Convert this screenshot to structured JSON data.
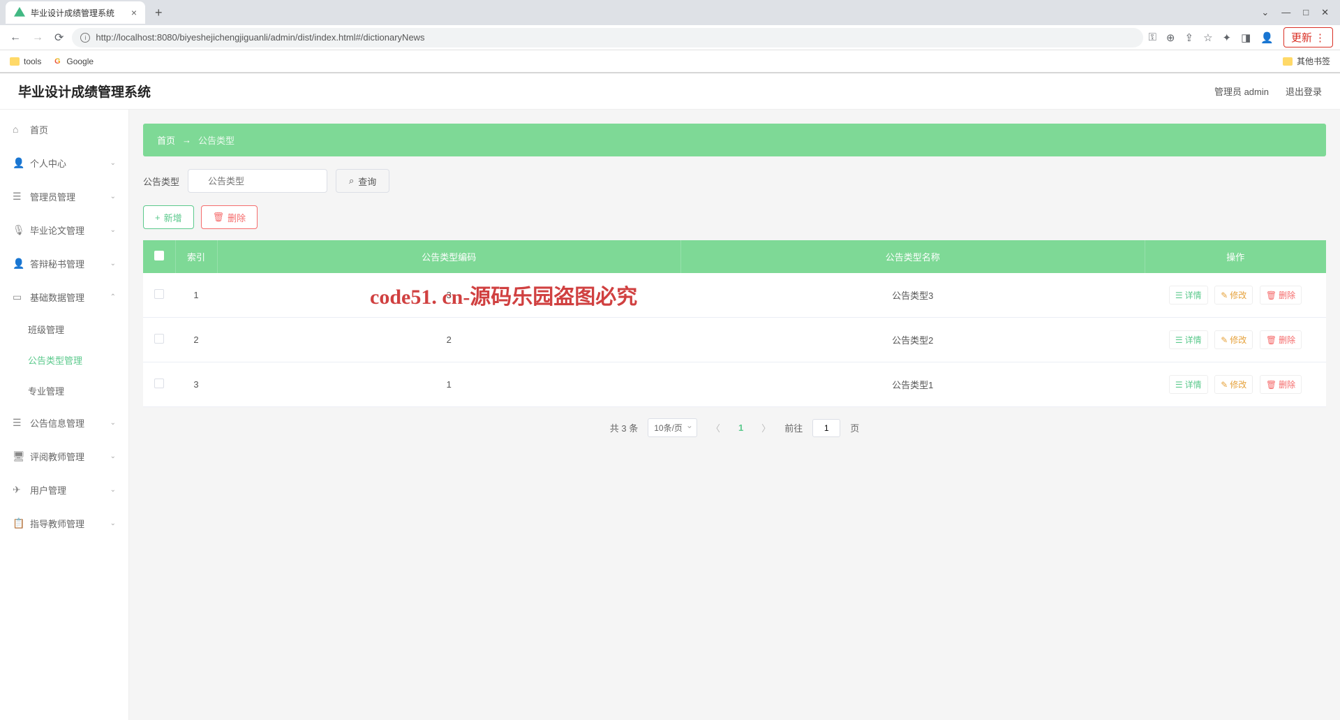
{
  "browser": {
    "tab_title": "毕业设计成绩管理系统",
    "url": "http://localhost:8080/biyeshejichengjiguanli/admin/dist/index.html#/dictionaryNews",
    "update_label": "更新",
    "bookmarks": {
      "tools": "tools",
      "google": "Google",
      "other": "其他书签"
    }
  },
  "header": {
    "title": "毕业设计成绩管理系统",
    "user": "管理员 admin",
    "logout": "退出登录"
  },
  "sidebar": {
    "items": [
      {
        "icon": "⌂",
        "label": "首页",
        "expandable": false
      },
      {
        "icon": "👤",
        "label": "个人中心",
        "expandable": true
      },
      {
        "icon": "☰",
        "label": "管理员管理",
        "expandable": true
      },
      {
        "icon": "🎙",
        "label": "毕业论文管理",
        "expandable": true
      },
      {
        "icon": "👤",
        "label": "答辩秘书管理",
        "expandable": true
      },
      {
        "icon": "▭",
        "label": "基础数据管理",
        "expandable": true,
        "expanded": true
      },
      {
        "icon": "☰",
        "label": "公告信息管理",
        "expandable": true
      },
      {
        "icon": "🖥",
        "label": "评阅教师管理",
        "expandable": true
      },
      {
        "icon": "✈",
        "label": "用户管理",
        "expandable": true
      },
      {
        "icon": "📋",
        "label": "指导教师管理",
        "expandable": true
      }
    ],
    "submenu": [
      {
        "label": "班级管理",
        "active": false
      },
      {
        "label": "公告类型管理",
        "active": true
      },
      {
        "label": "专业管理",
        "active": false
      }
    ]
  },
  "breadcrumb": {
    "home": "首页",
    "sep": "→",
    "current": "公告类型"
  },
  "search": {
    "label": "公告类型",
    "placeholder": "公告类型",
    "button": "查询"
  },
  "actions": {
    "add": "新增",
    "delete": "删除"
  },
  "table": {
    "headers": [
      "",
      "索引",
      "公告类型编码",
      "公告类型名称",
      "操作"
    ],
    "ops": {
      "view": "详情",
      "edit": "修改",
      "del": "删除"
    },
    "rows": [
      {
        "index": "1",
        "code": "3",
        "name": "公告类型3"
      },
      {
        "index": "2",
        "code": "2",
        "name": "公告类型2"
      },
      {
        "index": "3",
        "code": "1",
        "name": "公告类型1"
      }
    ]
  },
  "pagination": {
    "total": "共 3 条",
    "per_page": "10条/页",
    "current": "1",
    "goto_label": "前往",
    "goto_value": "1",
    "page_suffix": "页"
  },
  "watermark": "code51. cn-源码乐园盗图必究"
}
